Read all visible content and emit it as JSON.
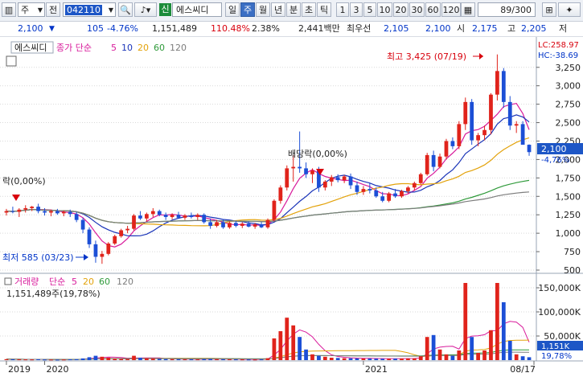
{
  "toolbar": {
    "market_select": "주",
    "jeon_label": "전",
    "stock_code": "042110",
    "stock_badge": "신",
    "stock_name": "에스씨디",
    "periods": [
      "일",
      "주",
      "월",
      "년",
      "분",
      "초",
      "틱"
    ],
    "active_period": "주",
    "minute_steps": [
      "1",
      "3",
      "5",
      "10",
      "20",
      "30",
      "60",
      "120"
    ],
    "count": "89/300"
  },
  "quote": {
    "price": "2,100",
    "change": "105",
    "change_pct": "-4.76%",
    "volume": "1,151,489",
    "volume_ratio": "110.48%",
    "turnover": "2.38%",
    "trade_value": "2,441백만",
    "best_bid_label": "최우선",
    "best_bid": "2,105",
    "best_ask": "2,100",
    "open_label": "시",
    "open": "2,175",
    "high_label": "고",
    "high": "2,205",
    "low_label": "저"
  },
  "price_panel": {
    "title": "에스씨디",
    "legend_label": "종가 단순",
    "ma": [
      {
        "period": "5",
        "color": "#d81b9b"
      },
      {
        "period": "10",
        "color": "#1a34b8"
      },
      {
        "period": "20",
        "color": "#e3a20a"
      },
      {
        "period": "60",
        "color": "#2f9a3a"
      },
      {
        "period": "120",
        "color": "#7c7c7c"
      }
    ],
    "lc_label": "LC:258.97",
    "hc_label": "HC:-38.69",
    "high_annot": "최고 3,425 (07/19)",
    "low_annot": "최저 585 (03/23)",
    "dividend_annot": "배당락(0,00%)",
    "dividend_annot_left": "락(0,00%)",
    "last_price": "2,100",
    "last_change": "-4,76%",
    "y_ticks": [
      "3,250",
      "3,000",
      "2,750",
      "2,500",
      "2,250",
      "2,000",
      "1,750",
      "1,500",
      "1,250",
      "1,000",
      "750",
      "500"
    ]
  },
  "volume_panel": {
    "title": "거래량",
    "legend_label": "단순",
    "ma": [
      {
        "period": "5",
        "color": "#d81b9b"
      },
      {
        "period": "20",
        "color": "#e3a20a"
      },
      {
        "period": "60",
        "color": "#2f9a3a"
      },
      {
        "period": "120",
        "color": "#7c7c7c"
      }
    ],
    "current": "1,151,489주(19,78%)",
    "last_value": "1,151K",
    "last_ratio": "19,78%",
    "y_ticks": [
      "150,000K",
      "100,000K",
      "50,000K"
    ]
  },
  "x_axis": {
    "labels": [
      "2019",
      "2020",
      "2021",
      "08/17"
    ]
  },
  "colors": {
    "up": "#e0231b",
    "down": "#1c4fd6",
    "grid": "#d9d9d9",
    "accent": "#3b6fc4"
  },
  "chart_data": {
    "type": "candlestick",
    "x_labels": [
      "2019",
      "2020",
      "2021",
      "08/17"
    ],
    "ylim": [
      500,
      3400
    ],
    "price_ticks": [
      500,
      750,
      1000,
      1250,
      1500,
      1750,
      2000,
      2250,
      2500,
      2750,
      3000,
      3250
    ],
    "candles": [
      [
        1280,
        1330,
        1240,
        1300
      ],
      [
        1300,
        1360,
        1270,
        1290
      ],
      [
        1290,
        1340,
        1220,
        1320
      ],
      [
        1320,
        1380,
        1280,
        1340
      ],
      [
        1340,
        1370,
        1300,
        1360
      ],
      [
        1360,
        1400,
        1270,
        1300
      ],
      [
        1300,
        1340,
        1240,
        1280
      ],
      [
        1280,
        1320,
        1230,
        1300
      ],
      [
        1300,
        1330,
        1250,
        1270
      ],
      [
        1270,
        1310,
        1230,
        1290
      ],
      [
        1290,
        1320,
        1220,
        1260
      ],
      [
        1260,
        1290,
        1150,
        1180
      ],
      [
        1180,
        1210,
        1000,
        1050
      ],
      [
        1050,
        1080,
        800,
        850
      ],
      [
        850,
        900,
        600,
        680
      ],
      [
        680,
        760,
        585,
        720
      ],
      [
        720,
        880,
        700,
        860
      ],
      [
        860,
        980,
        840,
        960
      ],
      [
        960,
        1060,
        940,
        1040
      ],
      [
        1040,
        1100,
        1000,
        1060
      ],
      [
        1060,
        1260,
        1040,
        1240
      ],
      [
        1240,
        1300,
        1180,
        1200
      ],
      [
        1200,
        1280,
        1160,
        1260
      ],
      [
        1260,
        1340,
        1220,
        1300
      ],
      [
        1300,
        1320,
        1230,
        1250
      ],
      [
        1250,
        1280,
        1180,
        1220
      ],
      [
        1220,
        1270,
        1190,
        1250
      ],
      [
        1250,
        1290,
        1200,
        1210
      ],
      [
        1210,
        1260,
        1180,
        1240
      ],
      [
        1240,
        1280,
        1200,
        1220
      ],
      [
        1220,
        1270,
        1180,
        1250
      ],
      [
        1250,
        1270,
        1130,
        1150
      ],
      [
        1150,
        1200,
        1060,
        1100
      ],
      [
        1100,
        1180,
        1080,
        1150
      ],
      [
        1150,
        1190,
        1060,
        1080
      ],
      [
        1080,
        1160,
        1060,
        1140
      ],
      [
        1140,
        1170,
        1080,
        1100
      ],
      [
        1100,
        1150,
        1070,
        1130
      ],
      [
        1130,
        1160,
        1080,
        1090
      ],
      [
        1090,
        1140,
        1060,
        1120
      ],
      [
        1120,
        1150,
        1070,
        1080
      ],
      [
        1080,
        1200,
        1060,
        1180
      ],
      [
        1180,
        1460,
        1160,
        1440
      ],
      [
        1440,
        1650,
        1400,
        1620
      ],
      [
        1620,
        1920,
        1580,
        1880
      ],
      [
        1880,
        2060,
        1700,
        1900
      ],
      [
        1900,
        2380,
        1820,
        1880
      ],
      [
        1880,
        1960,
        1750,
        1800
      ],
      [
        1800,
        1880,
        1680,
        1850
      ],
      [
        1850,
        1900,
        1560,
        1620
      ],
      [
        1620,
        1720,
        1580,
        1700
      ],
      [
        1700,
        1790,
        1640,
        1760
      ],
      [
        1760,
        1800,
        1690,
        1720
      ],
      [
        1720,
        1790,
        1680,
        1770
      ],
      [
        1770,
        1810,
        1600,
        1650
      ],
      [
        1650,
        1700,
        1520,
        1560
      ],
      [
        1560,
        1640,
        1520,
        1600
      ],
      [
        1600,
        1680,
        1540,
        1580
      ],
      [
        1580,
        1620,
        1480,
        1500
      ],
      [
        1500,
        1560,
        1420,
        1440
      ],
      [
        1440,
        1560,
        1420,
        1540
      ],
      [
        1540,
        1600,
        1480,
        1500
      ],
      [
        1500,
        1590,
        1480,
        1570
      ],
      [
        1570,
        1640,
        1540,
        1620
      ],
      [
        1620,
        1700,
        1580,
        1680
      ],
      [
        1680,
        1820,
        1660,
        1800
      ],
      [
        1800,
        2090,
        1780,
        2060
      ],
      [
        2060,
        2120,
        1840,
        1900
      ],
      [
        1900,
        2080,
        1880,
        2040
      ],
      [
        2040,
        2280,
        2000,
        2250
      ],
      [
        2250,
        2300,
        2140,
        2180
      ],
      [
        2180,
        2520,
        2140,
        2480
      ],
      [
        2480,
        2840,
        2400,
        2780
      ],
      [
        2780,
        2820,
        2200,
        2260
      ],
      [
        2260,
        2360,
        2180,
        2330
      ],
      [
        2330,
        2460,
        2260,
        2400
      ],
      [
        2400,
        2900,
        2340,
        2880
      ],
      [
        2880,
        3425,
        2800,
        3200
      ],
      [
        3200,
        3240,
        2700,
        2780
      ],
      [
        2780,
        2860,
        2400,
        2460
      ],
      [
        2460,
        2520,
        2360,
        2480
      ],
      [
        2480,
        2520,
        2310,
        2200
      ],
      [
        2200,
        2205,
        2050,
        2100
      ]
    ],
    "volume_max": 160000,
    "volume_ticks": [
      50000,
      100000,
      150000
    ],
    "volumes": [
      2000,
      1800,
      1600,
      1500,
      1400,
      1700,
      1300,
      1200,
      1100,
      1300,
      1600,
      1900,
      3500,
      6000,
      9000,
      7000,
      5000,
      3000,
      2500,
      2200,
      9000,
      5000,
      3500,
      3000,
      2500,
      2200,
      2000,
      1900,
      1800,
      1700,
      1600,
      2200,
      2500,
      2000,
      1800,
      1700,
      1600,
      1500,
      1400,
      1300,
      1600,
      4000,
      45000,
      60000,
      88000,
      72000,
      48000,
      22000,
      12000,
      9000,
      7000,
      5000,
      4500,
      4000,
      3800,
      3600,
      3400,
      3200,
      3000,
      2800,
      3000,
      3200,
      3400,
      3600,
      3800,
      8000,
      48000,
      52000,
      22000,
      12000,
      9000,
      20000,
      160000,
      48000,
      15000,
      20000,
      62000,
      160000,
      120000,
      40000,
      12000,
      8000,
      6000
    ]
  }
}
